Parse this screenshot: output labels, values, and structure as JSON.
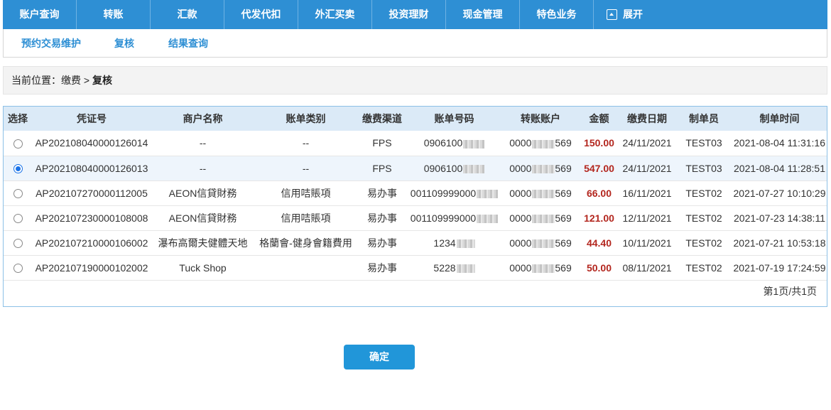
{
  "topnav": {
    "items": [
      "账户查询",
      "转账",
      "汇款",
      "代发代扣",
      "外汇买卖",
      "投资理财",
      "现金管理",
      "特色业务"
    ],
    "expand_label": "展开"
  },
  "subnav": {
    "items": [
      "预约交易维护",
      "复核",
      "结果查询"
    ]
  },
  "breadcrumb": {
    "prefix": "当前位置：缴费 > ",
    "current": "复核"
  },
  "table": {
    "headers": [
      "选择",
      "凭证号",
      "商户名称",
      "账单类别",
      "缴费渠道",
      "账单号码",
      "转账账户",
      "金额",
      "缴费日期",
      "制单员",
      "制单时间"
    ],
    "rows": [
      {
        "selected": false,
        "voucher": "AP202108040000126014",
        "merchant": "--",
        "category": "--",
        "channel": "FPS",
        "bill_prefix": "0906100",
        "account_prefix": "0000",
        "account_suffix": "569",
        "amount": "150.00",
        "date": "24/11/2021",
        "maker": "TEST03",
        "time": "2021-08-04 11:31:16"
      },
      {
        "selected": true,
        "voucher": "AP202108040000126013",
        "merchant": "--",
        "category": "--",
        "channel": "FPS",
        "bill_prefix": "0906100",
        "account_prefix": "0000",
        "account_suffix": "569",
        "amount": "547.00",
        "date": "24/11/2021",
        "maker": "TEST03",
        "time": "2021-08-04 11:28:51"
      },
      {
        "selected": false,
        "voucher": "AP202107270000112005",
        "merchant": "AEON信貸財務",
        "category": "信用咭賬項",
        "channel": "易办事",
        "bill_prefix": "001109999000",
        "account_prefix": "0000",
        "account_suffix": "569",
        "amount": "66.00",
        "date": "16/11/2021",
        "maker": "TEST02",
        "time": "2021-07-27 10:10:29"
      },
      {
        "selected": false,
        "voucher": "AP202107230000108008",
        "merchant": "AEON信貸財務",
        "category": "信用咭賬項",
        "channel": "易办事",
        "bill_prefix": "001109999000",
        "account_prefix": "0000",
        "account_suffix": "569",
        "amount": "121.00",
        "date": "12/11/2021",
        "maker": "TEST02",
        "time": "2021-07-23 14:38:11"
      },
      {
        "selected": false,
        "voucher": "AP202107210000106002",
        "merchant": "瀑布高爾夫健體天地",
        "category": "格蘭會-健身會籍費用",
        "channel": "易办事",
        "bill_prefix": "1234",
        "account_prefix": "0000",
        "account_suffix": "569",
        "amount": "44.40",
        "date": "10/11/2021",
        "maker": "TEST02",
        "time": "2021-07-21 10:53:18"
      },
      {
        "selected": false,
        "voucher": "AP202107190000102002",
        "merchant": "Tuck Shop",
        "category": "",
        "channel": "易办事",
        "bill_prefix": "5228",
        "account_prefix": "0000",
        "account_suffix": "569",
        "amount": "50.00",
        "date": "08/11/2021",
        "maker": "TEST02",
        "time": "2021-07-19 17:24:59"
      }
    ]
  },
  "pager": "第1页/共1页",
  "confirm_label": "确定",
  "colors": {
    "nav_blue": "#2e8fd4",
    "amount_red": "#b3261e",
    "button_blue": "#2196d9"
  }
}
